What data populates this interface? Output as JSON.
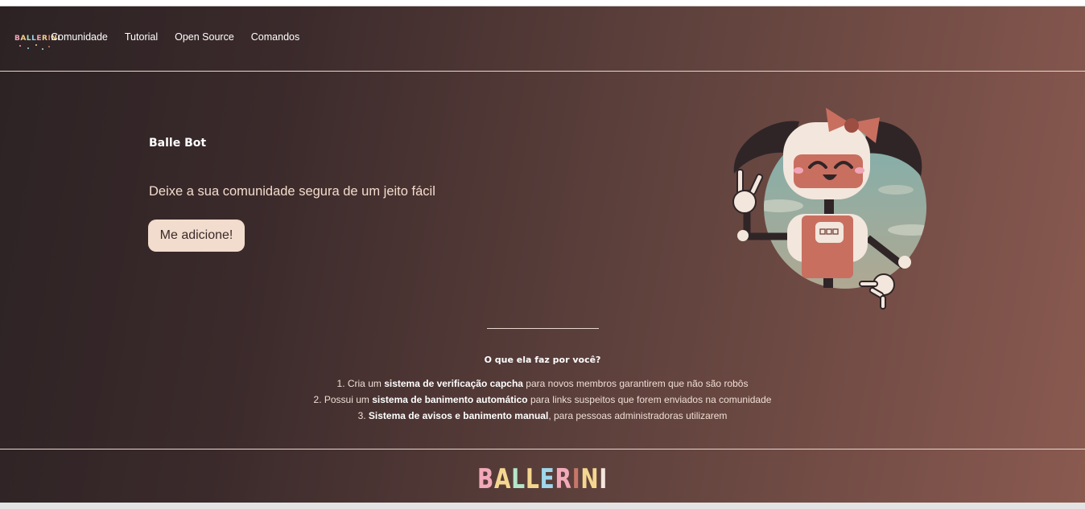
{
  "nav": {
    "logo_letters": [
      "B",
      "A",
      "L",
      "L",
      "E",
      "R",
      "I",
      "N",
      "I"
    ],
    "links": [
      "Comunidade",
      "Tutorial",
      "Open Source",
      "Comandos"
    ]
  },
  "hero": {
    "title": "Balle Bot",
    "subtitle": "Deixe a sua comunidade segura de um jeito fácil",
    "cta_label": "Me adicione!"
  },
  "features": {
    "title": "O que ela faz por você?",
    "items": [
      {
        "prefix": "1. Cria um ",
        "bold": "sistema de verificação capcha",
        "suffix": " para novos membros garantirem que não são robôs"
      },
      {
        "prefix": "2. Possui um ",
        "bold": "sistema de banimento automático",
        "suffix": " para links suspeitos que forem enviados na comunidade"
      },
      {
        "prefix": "3. ",
        "bold": "Sistema de avisos e banimento manual",
        "suffix": ", para pessoas administradoras utilizarem"
      }
    ]
  },
  "footer": {
    "logo_letters": [
      "B",
      "A",
      "L",
      "L",
      "E",
      "R",
      "I",
      "N",
      "I"
    ]
  },
  "colors": {
    "accent_button": "#f2dccd",
    "gradient_start": "#2c2224",
    "gradient_end": "#8a5a50"
  },
  "icons": {
    "mascot": "robot-girl-illustration"
  }
}
